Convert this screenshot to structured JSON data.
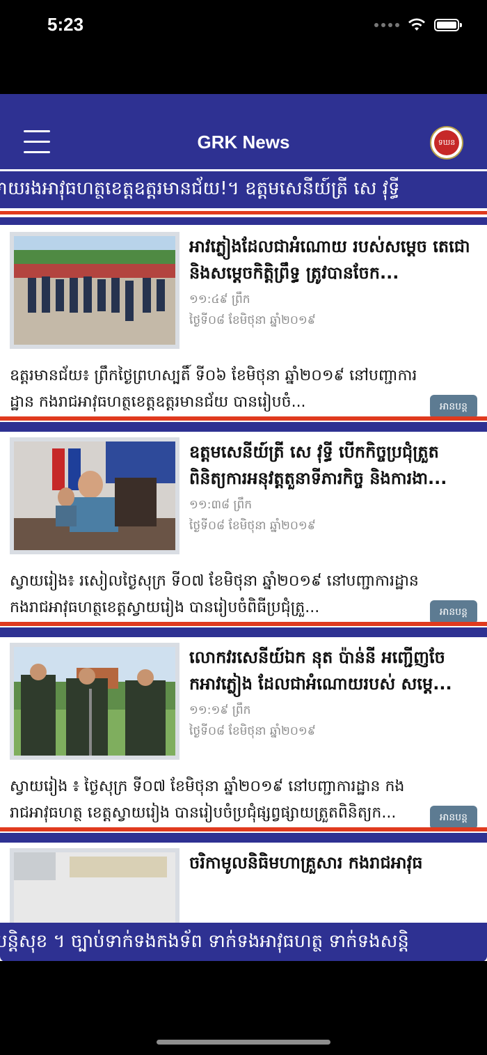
{
  "status": {
    "time": "5:23"
  },
  "nav": {
    "title": "GRK News",
    "logo_text": "ទឃន"
  },
  "ticker_top": "ាយរងអាវុធហត្ថខេត្តឧត្តរមានជ័យ!។ ឧត្តមសេនីយ៍ត្រី សេ វុទ្ធី",
  "ticker_bottom": "បន្តិសុខ ។ ច្បាប់ទាក់ទងកងទ័ព ទាក់ទងអាវុធហត្ថ ទាក់ទងសន្តិ",
  "articles": [
    {
      "headline": "អាវភ្លៀងដែលជាអំណោយ របស់សម្តេច តេជោ និងសម្តេចកិត្តិព្រឹទ្ធ ត្រូវបានចែក...",
      "time": "១១:៤៩ ព្រឹក",
      "date": "ថ្ងៃទី០៨ ខែមិថុនា ឆ្នាំ២០១៩",
      "summary": "ឧត្តរមានជ័យ៖ ព្រឹកថ្ងៃព្រហស្បតិ៍ ទី០៦ ខែមិថុនា ឆ្នាំ២០១៩ នៅបញ្ជាការដ្ឋាន កងរាជអាវុធហត្ថខេត្តឧត្តរមានជ័យ បានរៀបចំ...",
      "read_more": "អានបន្ត"
    },
    {
      "headline": "ឧត្តមសេនីយ៍ត្រី សេ វុទ្ធី បើកកិច្ចប្រជុំត្រួតពិនិត្យការអនុវត្តតួនាទីភារកិច្ច និងការងា...",
      "time": "១១:៣៨ ព្រឹក",
      "date": "ថ្ងៃទី០៨ ខែមិថុនា ឆ្នាំ២០១៩",
      "summary": "ស្វាយរៀង៖ រសៀលថ្ងៃសុក្រ ទី០៧ ខែមិថុនា ឆ្នាំ២០១៩ នៅបញ្ជាការដ្ឋាន កងរាជអាវុធហត្ថខេត្តស្វាយរៀង បានរៀបចំពិធីប្រជុំត្រួ...",
      "read_more": "អានបន្ត"
    },
    {
      "headline": "លោកវរសេនីយ៍ឯក នុត ប៉ាន់នី អញ្ជើញចែកអាវភ្លៀង ដែលជាអំណោយរបស់ សម្តេ...",
      "time": "១១:១៩ ព្រឹក",
      "date": "ថ្ងៃទី០៨ ខែមិថុនា ឆ្នាំ២០១៩",
      "summary": "ស្វាយរៀង ៖ ថ្ងៃសុក្រ ទី០៧ ខែមិថុនា ឆ្នាំ២០១៩ នៅបញ្ជាការដ្ឋាន កងរាជអាវុធហត្ថ ខេត្តស្វាយរៀង បានរៀបចំប្រជុំផ្សព្វផ្សាយត្រួតពិនិត្យក...",
      "read_more": "អានបន្ត"
    },
    {
      "headline": "ចរិកាមូលនិធិមហាគ្រួសារ កងរាជអាវុធ"
    }
  ]
}
